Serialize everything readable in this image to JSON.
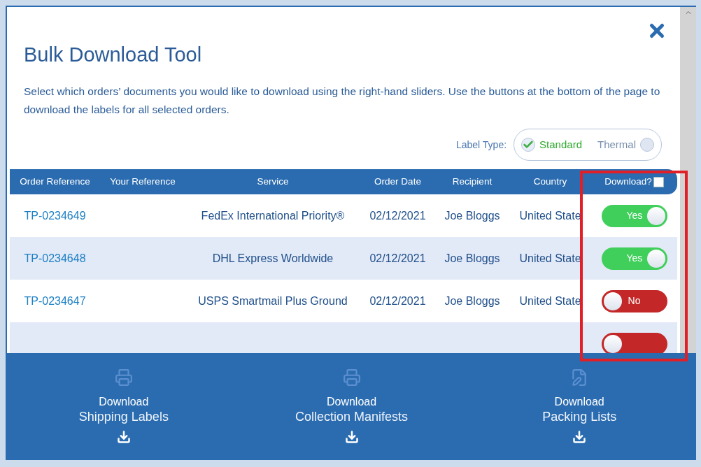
{
  "title": "Bulk Download Tool",
  "description": "Select which orders’ documents you would like to download using the right-hand sliders. Use the buttons at the bottom of the page to download the labels for all selected orders.",
  "label_type": {
    "label": "Label Type:",
    "options": [
      {
        "label": "Standard",
        "selected": true
      },
      {
        "label": "Thermal",
        "selected": false
      }
    ]
  },
  "table": {
    "columns": [
      "Order Reference",
      "Your Reference",
      "Service",
      "Order Date",
      "Recipient",
      "Country",
      "Download?"
    ],
    "select_all_checked": false,
    "rows": [
      {
        "order_reference": "TP-0234649",
        "service": "FedEx International Priority®",
        "order_date": "02/12/2021",
        "recipient": "Joe Bloggs",
        "country": "United State",
        "download": true,
        "toggle_label": "Yes"
      },
      {
        "order_reference": "TP-0234648",
        "service": "DHL Express Worldwide",
        "order_date": "02/12/2021",
        "recipient": "Joe Bloggs",
        "country": "United State",
        "download": true,
        "toggle_label": "Yes"
      },
      {
        "order_reference": "TP-0234647",
        "service": "USPS Smartmail Plus Ground",
        "order_date": "02/12/2021",
        "recipient": "Joe Bloggs",
        "country": "United State",
        "download": false,
        "toggle_label": "No"
      },
      {
        "download": false
      }
    ]
  },
  "footer_buttons": [
    {
      "kind": "labels",
      "title": "Download",
      "label": "Shipping Labels"
    },
    {
      "kind": "manifests",
      "title": "Download",
      "label": "Collection Manifests"
    },
    {
      "kind": "packing",
      "title": "Download",
      "label": "Packing Lists"
    }
  ]
}
